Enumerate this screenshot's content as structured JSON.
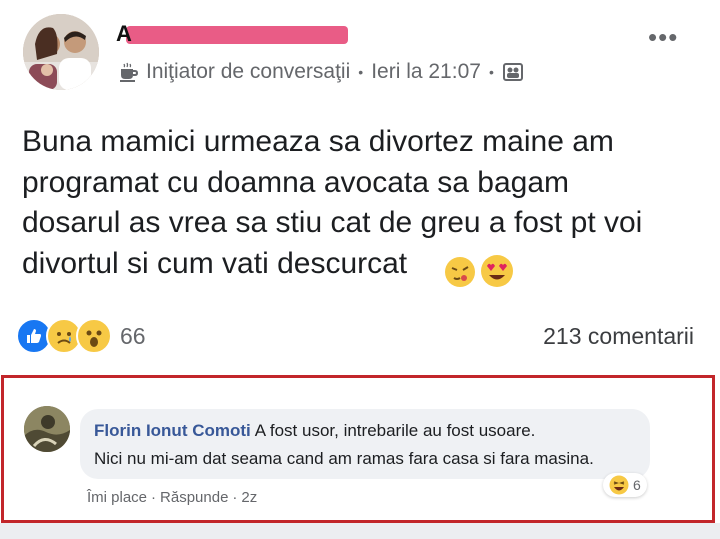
{
  "post": {
    "author_visible": "A                    ",
    "badge_label": "Iniţiator de conversaţii",
    "time": "Ieri la 21:07",
    "text": "Buna mamici urmeaza sa divortez maine am\nprogramat cu doamna avocata sa bagam\ndosarul as vrea sa stiu cat de greu a fost pt voi\ndivortul si cum vati descurcat",
    "reaction_count": "66",
    "comment_count": "213 comentarii",
    "icons": {
      "menu": "more-horizontal-icon",
      "badge": "coffee-cup-icon",
      "audience": "group-icon"
    },
    "colors": {
      "like": "#1877f2",
      "reaction_yellow": "#f7c945"
    }
  },
  "comment": {
    "author": "Florin Ionut Comoti",
    "line1": "A fost usor, intrebarile au fost usoare.",
    "line2": "Nici nu mi-am dat seama cand am ramas fara casa si fara masina.",
    "reaction_count": "6",
    "like_label": "Îmi place",
    "reply_label": "Răspunde",
    "time": "2z",
    "highlight_color": "#c2262a"
  }
}
